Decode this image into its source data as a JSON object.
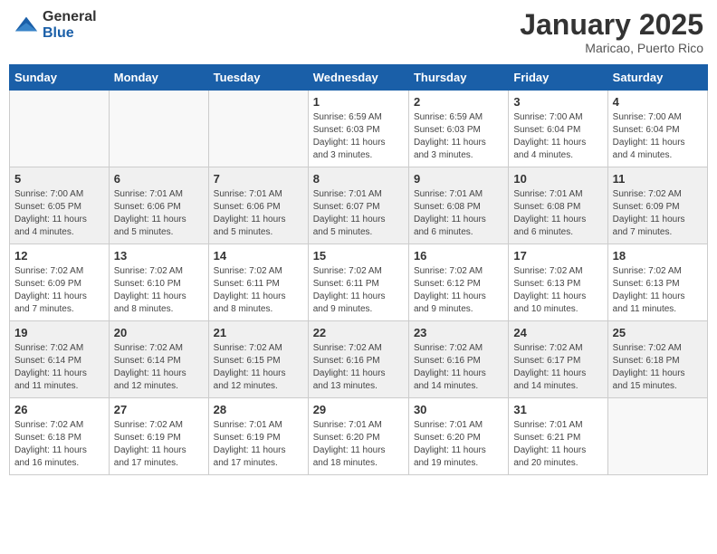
{
  "header": {
    "logo": {
      "general": "General",
      "blue": "Blue"
    },
    "title": "January 2025",
    "location": "Maricao, Puerto Rico"
  },
  "weekdays": [
    "Sunday",
    "Monday",
    "Tuesday",
    "Wednesday",
    "Thursday",
    "Friday",
    "Saturday"
  ],
  "weeks": [
    [
      {
        "day": "",
        "info": ""
      },
      {
        "day": "",
        "info": ""
      },
      {
        "day": "",
        "info": ""
      },
      {
        "day": "1",
        "info": "Sunrise: 6:59 AM\nSunset: 6:03 PM\nDaylight: 11 hours\nand 3 minutes."
      },
      {
        "day": "2",
        "info": "Sunrise: 6:59 AM\nSunset: 6:03 PM\nDaylight: 11 hours\nand 3 minutes."
      },
      {
        "day": "3",
        "info": "Sunrise: 7:00 AM\nSunset: 6:04 PM\nDaylight: 11 hours\nand 4 minutes."
      },
      {
        "day": "4",
        "info": "Sunrise: 7:00 AM\nSunset: 6:04 PM\nDaylight: 11 hours\nand 4 minutes."
      }
    ],
    [
      {
        "day": "5",
        "info": "Sunrise: 7:00 AM\nSunset: 6:05 PM\nDaylight: 11 hours\nand 4 minutes."
      },
      {
        "day": "6",
        "info": "Sunrise: 7:01 AM\nSunset: 6:06 PM\nDaylight: 11 hours\nand 5 minutes."
      },
      {
        "day": "7",
        "info": "Sunrise: 7:01 AM\nSunset: 6:06 PM\nDaylight: 11 hours\nand 5 minutes."
      },
      {
        "day": "8",
        "info": "Sunrise: 7:01 AM\nSunset: 6:07 PM\nDaylight: 11 hours\nand 5 minutes."
      },
      {
        "day": "9",
        "info": "Sunrise: 7:01 AM\nSunset: 6:08 PM\nDaylight: 11 hours\nand 6 minutes."
      },
      {
        "day": "10",
        "info": "Sunrise: 7:01 AM\nSunset: 6:08 PM\nDaylight: 11 hours\nand 6 minutes."
      },
      {
        "day": "11",
        "info": "Sunrise: 7:02 AM\nSunset: 6:09 PM\nDaylight: 11 hours\nand 7 minutes."
      }
    ],
    [
      {
        "day": "12",
        "info": "Sunrise: 7:02 AM\nSunset: 6:09 PM\nDaylight: 11 hours\nand 7 minutes."
      },
      {
        "day": "13",
        "info": "Sunrise: 7:02 AM\nSunset: 6:10 PM\nDaylight: 11 hours\nand 8 minutes."
      },
      {
        "day": "14",
        "info": "Sunrise: 7:02 AM\nSunset: 6:11 PM\nDaylight: 11 hours\nand 8 minutes."
      },
      {
        "day": "15",
        "info": "Sunrise: 7:02 AM\nSunset: 6:11 PM\nDaylight: 11 hours\nand 9 minutes."
      },
      {
        "day": "16",
        "info": "Sunrise: 7:02 AM\nSunset: 6:12 PM\nDaylight: 11 hours\nand 9 minutes."
      },
      {
        "day": "17",
        "info": "Sunrise: 7:02 AM\nSunset: 6:13 PM\nDaylight: 11 hours\nand 10 minutes."
      },
      {
        "day": "18",
        "info": "Sunrise: 7:02 AM\nSunset: 6:13 PM\nDaylight: 11 hours\nand 11 minutes."
      }
    ],
    [
      {
        "day": "19",
        "info": "Sunrise: 7:02 AM\nSunset: 6:14 PM\nDaylight: 11 hours\nand 11 minutes."
      },
      {
        "day": "20",
        "info": "Sunrise: 7:02 AM\nSunset: 6:14 PM\nDaylight: 11 hours\nand 12 minutes."
      },
      {
        "day": "21",
        "info": "Sunrise: 7:02 AM\nSunset: 6:15 PM\nDaylight: 11 hours\nand 12 minutes."
      },
      {
        "day": "22",
        "info": "Sunrise: 7:02 AM\nSunset: 6:16 PM\nDaylight: 11 hours\nand 13 minutes."
      },
      {
        "day": "23",
        "info": "Sunrise: 7:02 AM\nSunset: 6:16 PM\nDaylight: 11 hours\nand 14 minutes."
      },
      {
        "day": "24",
        "info": "Sunrise: 7:02 AM\nSunset: 6:17 PM\nDaylight: 11 hours\nand 14 minutes."
      },
      {
        "day": "25",
        "info": "Sunrise: 7:02 AM\nSunset: 6:18 PM\nDaylight: 11 hours\nand 15 minutes."
      }
    ],
    [
      {
        "day": "26",
        "info": "Sunrise: 7:02 AM\nSunset: 6:18 PM\nDaylight: 11 hours\nand 16 minutes."
      },
      {
        "day": "27",
        "info": "Sunrise: 7:02 AM\nSunset: 6:19 PM\nDaylight: 11 hours\nand 17 minutes."
      },
      {
        "day": "28",
        "info": "Sunrise: 7:01 AM\nSunset: 6:19 PM\nDaylight: 11 hours\nand 17 minutes."
      },
      {
        "day": "29",
        "info": "Sunrise: 7:01 AM\nSunset: 6:20 PM\nDaylight: 11 hours\nand 18 minutes."
      },
      {
        "day": "30",
        "info": "Sunrise: 7:01 AM\nSunset: 6:20 PM\nDaylight: 11 hours\nand 19 minutes."
      },
      {
        "day": "31",
        "info": "Sunrise: 7:01 AM\nSunset: 6:21 PM\nDaylight: 11 hours\nand 20 minutes."
      },
      {
        "day": "",
        "info": ""
      }
    ]
  ]
}
